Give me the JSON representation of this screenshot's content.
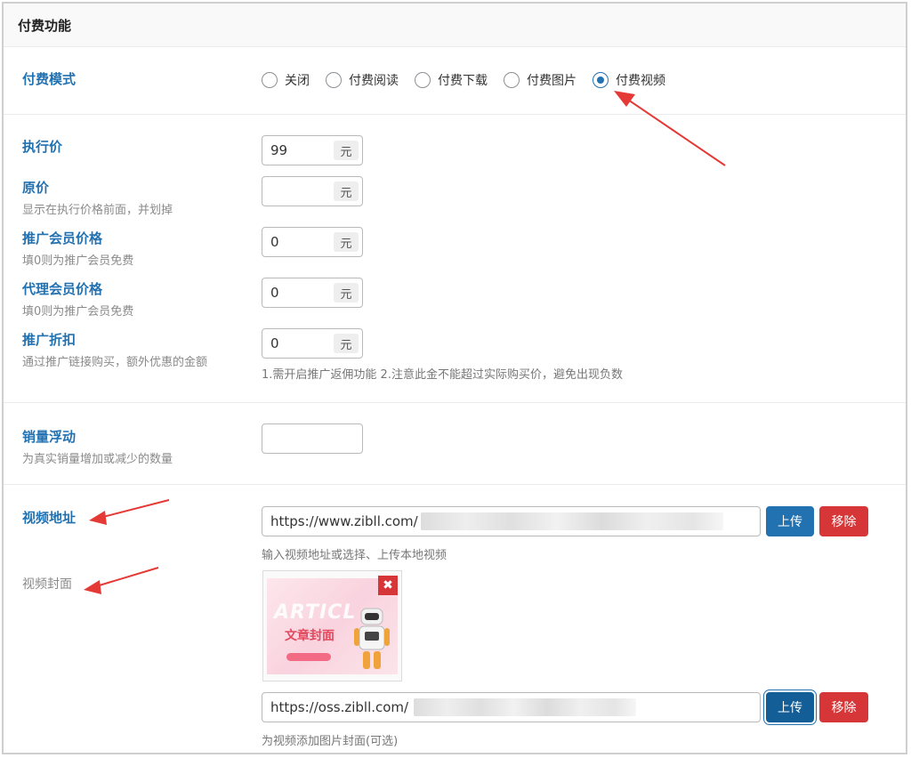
{
  "header": {
    "title": "付费功能"
  },
  "pay_mode": {
    "label": "付费模式",
    "options": [
      "关闭",
      "付费阅读",
      "付费下载",
      "付费图片",
      "付费视频"
    ],
    "selected_index": 4
  },
  "prices": {
    "unit": "元",
    "exec": {
      "label": "执行价",
      "value": "99"
    },
    "original": {
      "label": "原价",
      "desc": "显示在执行价格前面，并划掉",
      "value": ""
    },
    "promo_member": {
      "label": "推广会员价格",
      "desc": "填0则为推广会员免费",
      "value": "0"
    },
    "agent_member": {
      "label": "代理会员价格",
      "desc": "填0则为推广会员免费",
      "value": "0"
    },
    "promo_discount": {
      "label": "推广折扣",
      "desc": "通过推广链接购买，额外优惠的金额",
      "value": "0",
      "note": "1.需开启推广返佣功能 2.注意此金不能超过实际购买价，避免出现负数"
    }
  },
  "sales_float": {
    "label": "销量浮动",
    "desc": "为真实销量增加或减少的数量",
    "value": ""
  },
  "video_url": {
    "label": "视频地址",
    "value": "https://www.zibll.com/",
    "help": "输入视频地址或选择、上传本地视频",
    "upload": "上传",
    "remove": "移除"
  },
  "video_cover": {
    "label": "视频封面",
    "value": "https://oss.zibll.com/",
    "help": "为视频添加图片封面(可选)",
    "upload": "上传",
    "remove": "移除",
    "thumb": {
      "watermark": "ARTICL",
      "title": "文章封面",
      "remove_symbol": "✖"
    }
  },
  "colors": {
    "accent": "#2271b1",
    "danger": "#d63638",
    "arrow": "#e53935"
  }
}
